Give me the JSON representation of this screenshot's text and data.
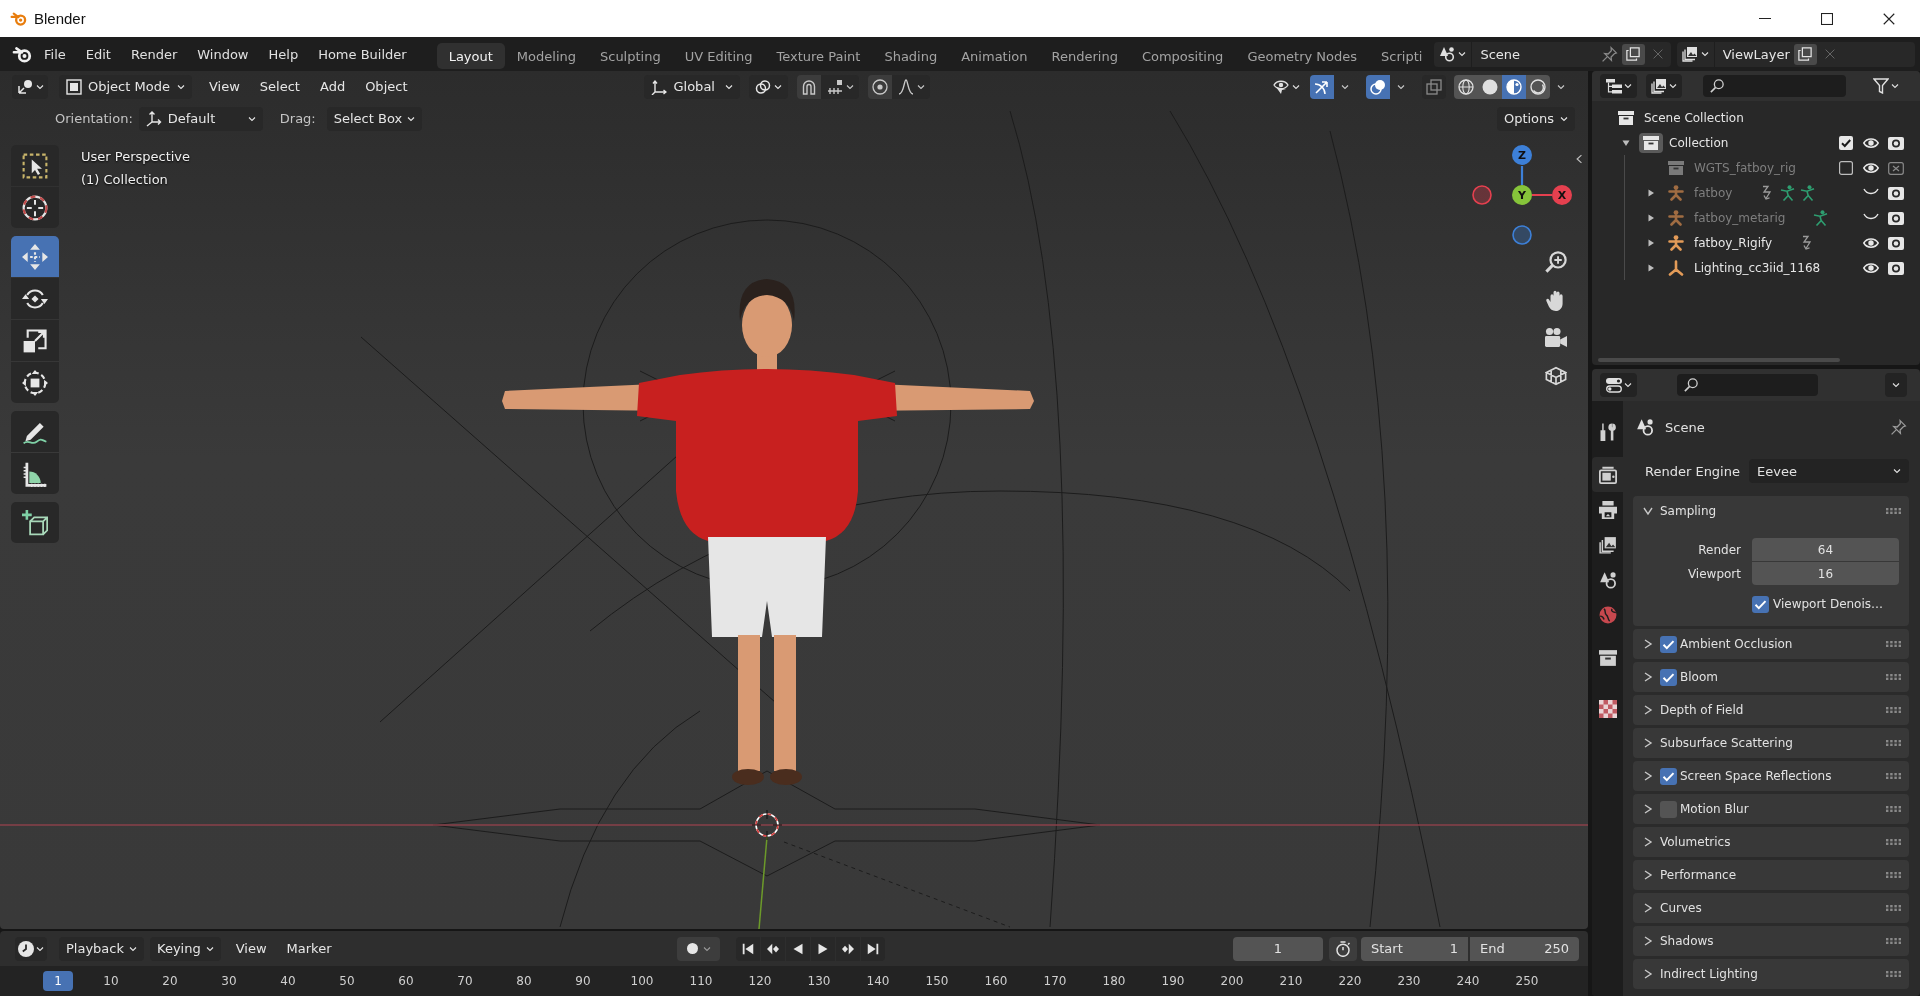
{
  "window": {
    "title": "Blender"
  },
  "menu_bar": {
    "menus": [
      "File",
      "Edit",
      "Render",
      "Window",
      "Help",
      "Home Builder"
    ]
  },
  "workspaces": [
    {
      "label": "Layout",
      "selected": true
    },
    {
      "label": "Modeling",
      "selected": false
    },
    {
      "label": "Sculpting",
      "selected": false
    },
    {
      "label": "UV Editing",
      "selected": false
    },
    {
      "label": "Texture Paint",
      "selected": false
    },
    {
      "label": "Shading",
      "selected": false
    },
    {
      "label": "Animation",
      "selected": false
    },
    {
      "label": "Rendering",
      "selected": false
    },
    {
      "label": "Compositing",
      "selected": false
    },
    {
      "label": "Geometry Nodes",
      "selected": false
    },
    {
      "label": "Scripti",
      "selected": false
    }
  ],
  "scene": {
    "value": "Scene"
  },
  "view_layer": {
    "value": "ViewLayer"
  },
  "viewport": {
    "header": {
      "mode": "Object Mode",
      "menus": [
        "View",
        "Select",
        "Add",
        "Object"
      ],
      "orientation": "Global",
      "snap_on": false,
      "proportional_on": false,
      "gizmos_on": true,
      "overlays_on": true,
      "xray_on": false,
      "shading_modes": [
        {
          "kind": "wireframe",
          "selected": false
        },
        {
          "kind": "solid",
          "selected": false
        },
        {
          "kind": "material",
          "selected": true
        },
        {
          "kind": "rendered",
          "selected": false
        }
      ]
    },
    "tool_settings": {
      "orientation_label": "Orientation:",
      "orientation": "Default",
      "drag_label": "Drag:",
      "drag": "Select Box",
      "options": "Options"
    },
    "tool_groups": [
      {
        "tools": [
          {
            "kind": "select_box",
            "selected": false
          },
          {
            "kind": "cursor",
            "selected": false
          }
        ]
      },
      {
        "tools": [
          {
            "kind": "move",
            "selected": true
          },
          {
            "kind": "rotate",
            "selected": false
          },
          {
            "kind": "scale",
            "selected": false
          },
          {
            "kind": "transform",
            "selected": false
          }
        ]
      },
      {
        "tools": [
          {
            "kind": "annotate",
            "selected": false
          },
          {
            "kind": "measure",
            "selected": false
          }
        ]
      },
      {
        "tools": [
          {
            "kind": "add_cube",
            "selected": false
          }
        ]
      }
    ],
    "info": [
      "User Perspective",
      "(1) Collection"
    ],
    "gizmo_axes": [
      {
        "label": "Z",
        "color": "#3d80d8"
      },
      {
        "label": "Y",
        "color": "#86c43a"
      },
      {
        "label": "X",
        "color": "#e5404f"
      }
    ]
  },
  "outliner": {
    "tree": [
      {
        "name": "Scene Collection",
        "kind": "scene_collection",
        "children": [
          {
            "name": "Collection",
            "kind": "collection",
            "expanded": true,
            "active": true,
            "checked": true,
            "visible": true,
            "children": [
              {
                "name": "WGTS_fatboy_rig",
                "kind": "collection",
                "checked": false,
                "visible": true
              },
              {
                "name": "fatboy",
                "kind": "armature",
                "expanded": false,
                "visible": false,
                "extra_icons": [
                  {
                    "kind": "constraint"
                  },
                  {
                    "kind": "pose"
                  },
                  {
                    "kind": "pose"
                  }
                ]
              },
              {
                "name": "fatboy_metarig",
                "kind": "armature",
                "expanded": false,
                "visible": false,
                "extra_icons": [
                  {
                    "kind": "pose"
                  }
                ]
              },
              {
                "name": "fatboy_Rigify",
                "kind": "armature",
                "expanded": false,
                "visible": true,
                "extra_icons": [
                  {
                    "kind": "constraint"
                  }
                ]
              },
              {
                "name": "Lighting_cc3iid_1168",
                "kind": "empty",
                "expanded": false,
                "visible": true
              }
            ]
          }
        ]
      }
    ]
  },
  "properties": {
    "tab_groups": [
      {
        "tabs": [
          {
            "kind": "tool",
            "selected": false
          }
        ]
      },
      {
        "tabs": [
          {
            "kind": "render",
            "selected": true
          },
          {
            "kind": "output",
            "selected": false
          },
          {
            "kind": "view_layer",
            "selected": false
          },
          {
            "kind": "scene",
            "selected": false
          },
          {
            "kind": "world",
            "selected": false
          }
        ]
      },
      {
        "tabs": [
          {
            "kind": "collection",
            "selected": false
          }
        ]
      },
      {
        "tabs": [
          {
            "kind": "texture",
            "selected": false
          }
        ]
      }
    ],
    "context": "Scene",
    "render_engine": {
      "label": "Render Engine",
      "value": "Eevee"
    },
    "panels": [
      {
        "title": "Sampling",
        "kind": "plain",
        "expanded": true,
        "fields": [
          {
            "label": "Render",
            "value": "64"
          },
          {
            "label": "Viewport",
            "value": "16"
          }
        ],
        "options": [
          {
            "label": "Viewport Denois…",
            "checked": true
          }
        ]
      },
      {
        "title": "Ambient Occlusion",
        "kind": "toggle",
        "expanded": false,
        "checked": true
      },
      {
        "title": "Bloom",
        "kind": "toggle",
        "expanded": false,
        "checked": true
      },
      {
        "title": "Depth of Field",
        "kind": "plain",
        "expanded": false
      },
      {
        "title": "Subsurface Scattering",
        "kind": "plain",
        "expanded": false
      },
      {
        "title": "Screen Space Reflections",
        "kind": "toggle",
        "expanded": false,
        "checked": true
      },
      {
        "title": "Motion Blur",
        "kind": "toggle",
        "expanded": false,
        "checked": false
      },
      {
        "title": "Volumetrics",
        "kind": "plain",
        "expanded": false
      },
      {
        "title": "Performance",
        "kind": "plain",
        "expanded": false
      },
      {
        "title": "Curves",
        "kind": "plain",
        "expanded": false
      },
      {
        "title": "Shadows",
        "kind": "plain",
        "expanded": false
      },
      {
        "title": "Indirect Lighting",
        "kind": "plain",
        "expanded": false
      }
    ]
  },
  "timeline": {
    "menus": [
      {
        "label": "Playback",
        "kind": "dropdown"
      },
      {
        "label": "Keying",
        "kind": "dropdown"
      },
      {
        "label": "View",
        "kind": "menu"
      },
      {
        "label": "Marker",
        "kind": "menu"
      }
    ],
    "auto_keying": false,
    "current_frame": "1",
    "start": {
      "label": "Start",
      "value": "1"
    },
    "end": {
      "label": "End",
      "value": "250"
    },
    "ruler": [
      {
        "label": "1",
        "selected": true
      },
      {
        "label": "10",
        "selected": false
      },
      {
        "label": "20",
        "selected": false
      },
      {
        "label": "30",
        "selected": false
      },
      {
        "label": "40",
        "selected": false
      },
      {
        "label": "50",
        "selected": false
      },
      {
        "label": "60",
        "selected": false
      },
      {
        "label": "70",
        "selected": false
      },
      {
        "label": "80",
        "selected": false
      },
      {
        "label": "90",
        "selected": false
      },
      {
        "label": "100",
        "selected": false
      },
      {
        "label": "110",
        "selected": false
      },
      {
        "label": "120",
        "selected": false
      },
      {
        "label": "130",
        "selected": false
      },
      {
        "label": "140",
        "selected": false
      },
      {
        "label": "150",
        "selected": false
      },
      {
        "label": "160",
        "selected": false
      },
      {
        "label": "170",
        "selected": false
      },
      {
        "label": "180",
        "selected": false
      },
      {
        "label": "190",
        "selected": false
      },
      {
        "label": "200",
        "selected": false
      },
      {
        "label": "210",
        "selected": false
      },
      {
        "label": "220",
        "selected": false
      },
      {
        "label": "230",
        "selected": false
      },
      {
        "label": "240",
        "selected": false
      },
      {
        "label": "250",
        "selected": false
      }
    ]
  }
}
